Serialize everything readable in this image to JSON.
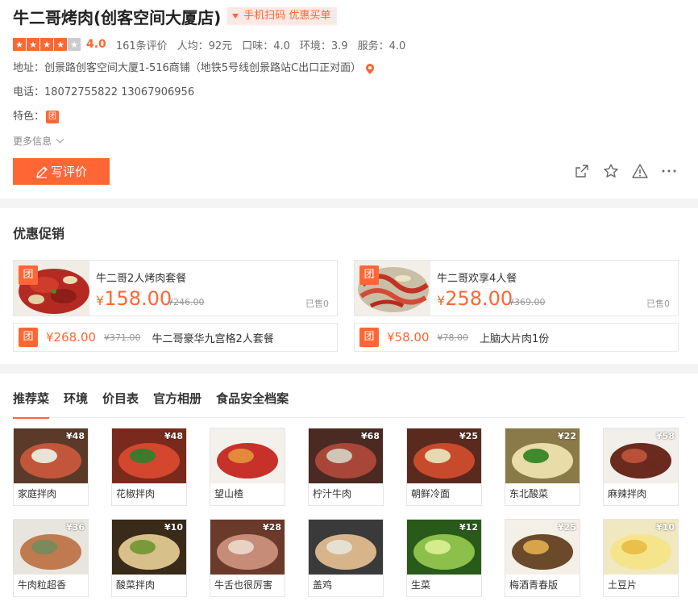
{
  "shop": {
    "title": "牛二哥烤肉(创客空间大厦店)",
    "scan_badge": "手机扫码 优惠买单",
    "rating": {
      "stars_filled": 4,
      "stars_total": 5,
      "score": "4.0",
      "reviews": "161条评价",
      "avg_price": "人均：92元",
      "taste": "口味：4.0",
      "environment": "环境：3.9",
      "service": "服务：4.0"
    },
    "address": "地址：创景路创客空间大厦1-516商铺（地铁5号线创景路站C出口正对面）",
    "phone": "电话：18072755822 13067906956",
    "feature_label": "特色：",
    "feature_badge": "团",
    "more_info": "更多信息",
    "write_review": "写评价",
    "accent": "#ff6633"
  },
  "promo": {
    "title": "优惠促销",
    "big": [
      {
        "name": "牛二哥2人烤肉套餐",
        "yen": "¥",
        "price": "158.00",
        "orig": "¥246.00",
        "sold": "已售0",
        "badge": "团"
      },
      {
        "name": "牛二哥欢享4人餐",
        "yen": "¥",
        "price": "258.00",
        "orig": "¥369.00",
        "sold": "已售0",
        "badge": "团"
      }
    ],
    "small": [
      {
        "price": "¥268.00",
        "orig": "¥371.00",
        "name": "牛二哥豪华九宫格2人套餐",
        "badge": "团"
      },
      {
        "price": "¥58.00",
        "orig": "¥78.00",
        "name": "上脑大片肉1份",
        "badge": "团"
      }
    ]
  },
  "dishes": {
    "tabs": [
      "推荐菜",
      "环境",
      "价目表",
      "官方相册",
      "食品安全档案"
    ],
    "items": [
      {
        "name": "家庭拌肉",
        "price": "¥48"
      },
      {
        "name": "花椒拌肉",
        "price": "¥48"
      },
      {
        "name": "望山楂",
        "price": ""
      },
      {
        "name": "柠汁牛肉",
        "price": "¥68"
      },
      {
        "name": "朝鲜冷面",
        "price": "¥25"
      },
      {
        "name": "东北酸菜",
        "price": "¥22"
      },
      {
        "name": "麻辣拌肉",
        "price": "¥58"
      },
      {
        "name": "牛肉粒超香",
        "price": "¥36"
      },
      {
        "name": "酸菜拌肉",
        "price": "¥10"
      },
      {
        "name": "牛舌也很厉害",
        "price": "¥28"
      },
      {
        "name": "盖鸡",
        "price": ""
      },
      {
        "name": "生菜",
        "price": "¥12"
      },
      {
        "name": "梅酒青春版",
        "price": "¥25"
      },
      {
        "name": "土豆片",
        "price": "¥10"
      }
    ]
  }
}
